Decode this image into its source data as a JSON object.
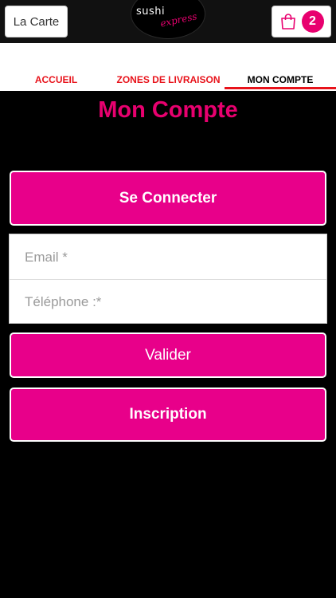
{
  "header": {
    "menu_label": "La Carte",
    "cart_count": "2",
    "logo_text": "sushi",
    "logo_script": "express"
  },
  "tabs": [
    {
      "label": "ACCUEIL",
      "active": false
    },
    {
      "label": "ZONES DE LIVRAISON",
      "active": false
    },
    {
      "label": "MON COMPTE",
      "active": true
    }
  ],
  "main": {
    "title": "Mon Compte",
    "connect_label": "Se Connecter",
    "email_placeholder": "Email *",
    "phone_placeholder": "Téléphone :*",
    "validate_label": "Valider",
    "signup_label": "Inscription"
  },
  "colors": {
    "accent": "#e8008a",
    "title": "#e8006f",
    "tab_text": "#e8131b",
    "background": "#000000"
  },
  "icons": [
    "shopping-bag-icon"
  ]
}
